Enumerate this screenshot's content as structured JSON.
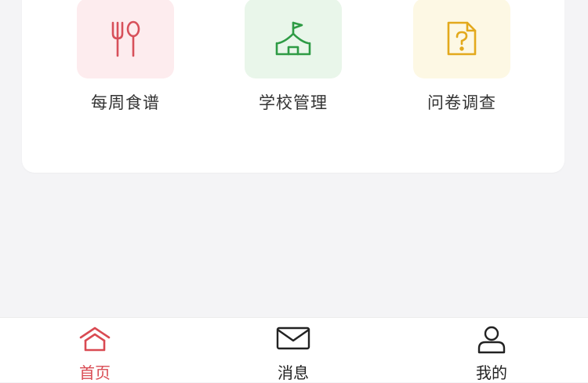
{
  "grid": [
    {
      "label": "每周食谱",
      "icon": "fork-spoon-icon",
      "tile_color": "#fdecee",
      "icon_color": "#d7505a"
    },
    {
      "label": "学校管理",
      "icon": "school-flag-icon",
      "tile_color": "#e9f6ea",
      "icon_color": "#2e9b45"
    },
    {
      "label": "问卷调查",
      "icon": "question-document-icon",
      "tile_color": "#fdf8e4",
      "icon_color": "#e3a91c"
    }
  ],
  "tabbar": {
    "items": [
      {
        "label": "首页",
        "icon": "home-icon",
        "active": true
      },
      {
        "label": "消息",
        "icon": "mail-icon",
        "active": false
      },
      {
        "label": "我的",
        "icon": "user-icon",
        "active": false
      }
    ],
    "active_color": "#d94a52",
    "inactive_color": "#222222"
  }
}
